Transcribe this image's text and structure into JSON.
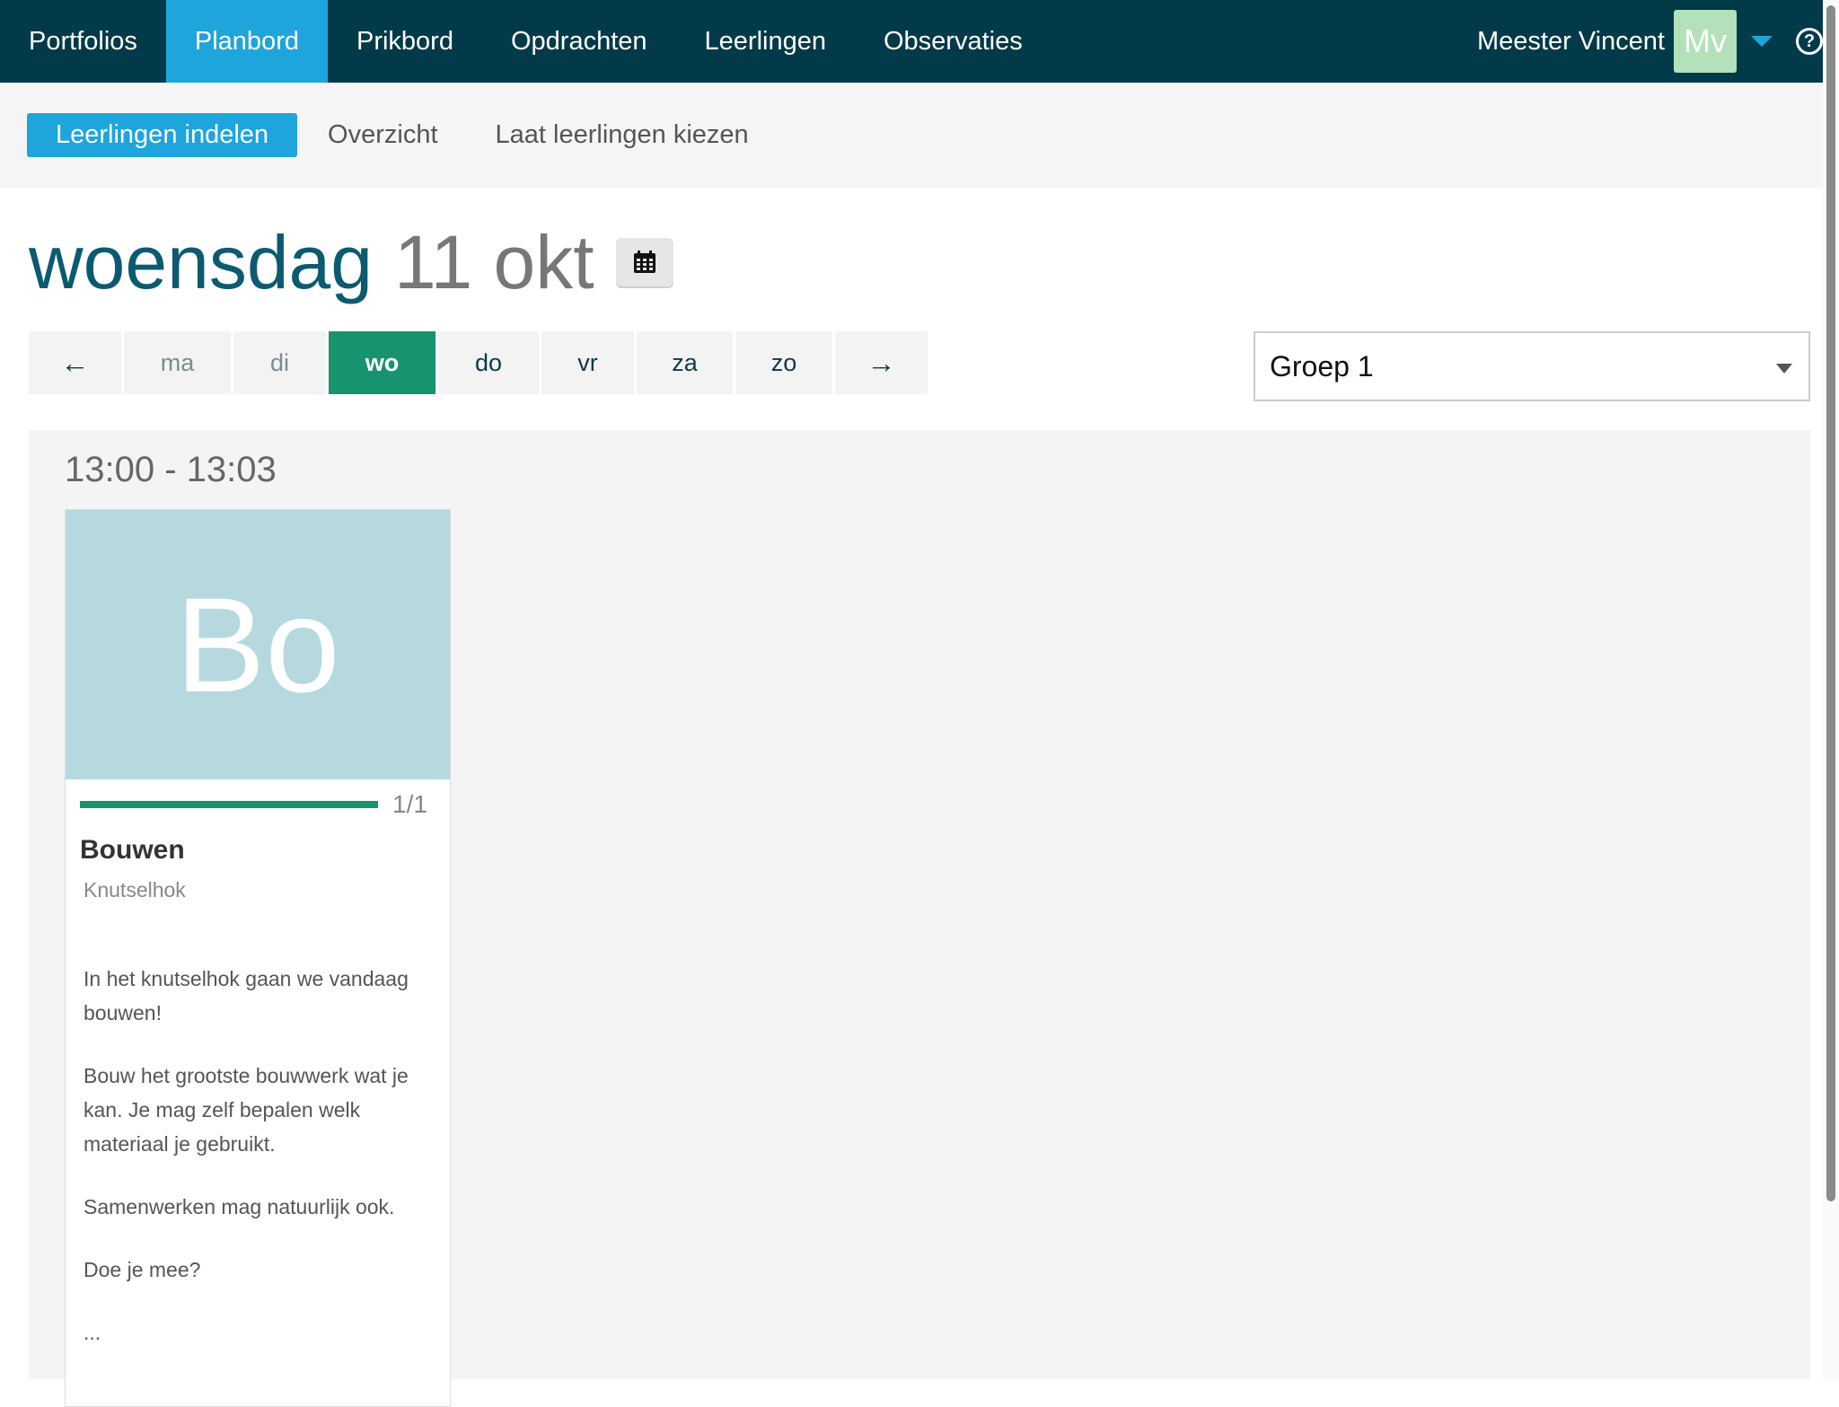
{
  "nav": {
    "items": [
      {
        "label": "Portfolios",
        "active": false
      },
      {
        "label": "Planbord",
        "active": true
      },
      {
        "label": "Prikbord",
        "active": false
      },
      {
        "label": "Opdrachten",
        "active": false
      },
      {
        "label": "Leerlingen",
        "active": false
      },
      {
        "label": "Observaties",
        "active": false
      }
    ],
    "user_name": "Meester Vincent",
    "avatar_initials": "Mv",
    "help_icon": "?"
  },
  "subnav": {
    "items": [
      {
        "label": "Leerlingen indelen",
        "active": true
      },
      {
        "label": "Overzicht",
        "active": false
      },
      {
        "label": "Laat leerlingen kiezen",
        "active": false
      }
    ]
  },
  "date": {
    "day_name": "woensdag",
    "day_date": "11 okt"
  },
  "week": {
    "prev_label": "←",
    "next_label": "→",
    "days": [
      {
        "label": "ma",
        "state": "muted"
      },
      {
        "label": "di",
        "state": "muted"
      },
      {
        "label": "wo",
        "state": "active"
      },
      {
        "label": "do",
        "state": "normal"
      },
      {
        "label": "vr",
        "state": "normal"
      },
      {
        "label": "za",
        "state": "normal"
      },
      {
        "label": "zo",
        "state": "normal"
      }
    ]
  },
  "group_select": {
    "value": "Groep 1"
  },
  "slot": {
    "time": "13:00 - 13:03",
    "card": {
      "initials": "Bo",
      "progress_fraction": 1.0,
      "progress_label": "1/1",
      "title": "Bouwen",
      "subtitle": "Knutselhok",
      "description": [
        "In het knutselhok gaan we vandaag bouwen!",
        "Bouw het grootste bouwwerk wat je kan. Je mag zelf bepalen welk materiaal je gebruikt.",
        "Samenwerken mag natuurlijk ook.",
        "Doe je mee?",
        "..."
      ]
    }
  },
  "colors": {
    "nav_bg": "#023a4a",
    "accent_blue": "#1ea5dc",
    "accent_green": "#17936f",
    "card_thumb": "#b5d9df",
    "avatar_bg": "#b3e1b9"
  }
}
